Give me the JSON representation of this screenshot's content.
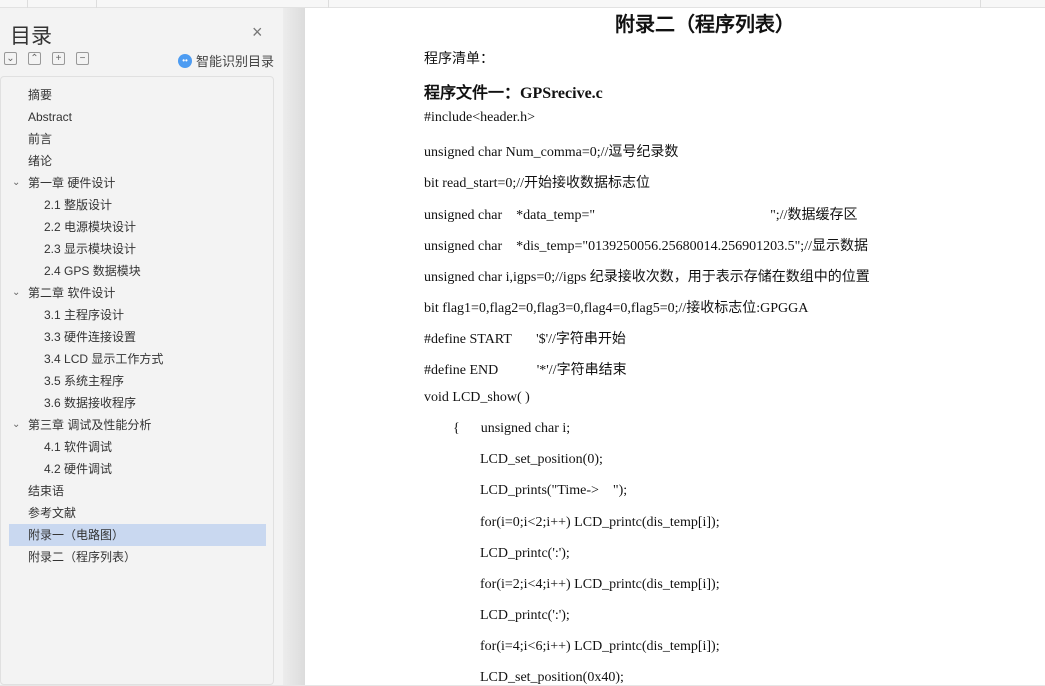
{
  "sidebar": {
    "title": "目录",
    "close": "×",
    "controls": [
      "⌄",
      "⌃",
      "+",
      "−"
    ],
    "smart_label": "智能识别目录",
    "items": [
      {
        "label": "摘要",
        "level": 1
      },
      {
        "label": "Abstract",
        "level": 1
      },
      {
        "label": "前言",
        "level": 1
      },
      {
        "label": "绪论",
        "level": 1
      },
      {
        "label": "第一章  硬件设计",
        "level": 1,
        "expanded": true
      },
      {
        "label": "2.1  整版设计",
        "level": 2
      },
      {
        "label": "2.2  电源模块设计",
        "level": 2
      },
      {
        "label": "2.3  显示模块设计",
        "level": 2
      },
      {
        "label": "2.4 GPS 数据模块",
        "level": 2
      },
      {
        "label": "第二章  软件设计",
        "level": 1,
        "expanded": true
      },
      {
        "label": "3.1  主程序设计",
        "level": 2
      },
      {
        "label": "3.3  硬件连接设置",
        "level": 2
      },
      {
        "label": "3.4 LCD 显示工作方式",
        "level": 2
      },
      {
        "label": "3.5  系统主程序",
        "level": 2
      },
      {
        "label": "3.6  数据接收程序",
        "level": 2
      },
      {
        "label": "第三章   调试及性能分析",
        "level": 1,
        "expanded": true
      },
      {
        "label": "4.1 软件调试",
        "level": 2
      },
      {
        "label": "4.2 硬件调试",
        "level": 2
      },
      {
        "label": "结束语",
        "level": 1
      },
      {
        "label": "参考文献",
        "level": 1
      },
      {
        "label": "附录一（电路图）",
        "level": 1,
        "selected": true
      },
      {
        "label": "附录二（程序列表）",
        "level": 1
      }
    ]
  },
  "document": {
    "title": "附录二（程序列表）",
    "lines": [
      {
        "text": "程序清单：",
        "indent": 0
      },
      {
        "text": "程序文件一：GPSrecive.c",
        "indent": 0,
        "heading": true
      },
      {
        "text": "#include<header.h>",
        "indent": 0
      },
      {
        "text": "unsigned char Num_comma=0;//逗号纪录数",
        "indent": 0
      },
      {
        "text": "bit read_start=0;//开始接收数据标志位",
        "indent": 0
      },
      {
        "text": "unsigned char    *data_temp=\"                                                  \";//数据缓存区",
        "indent": 0
      },
      {
        "text": "unsigned char    *dis_temp=\"0139250056.25680014.256901203.5\";//显示数据",
        "indent": 0
      },
      {
        "text": "unsigned char i,igps=0;//igps 纪录接收次数，用于表示存储在数组中的位置",
        "indent": 0
      },
      {
        "text": "bit flag1=0,flag2=0,flag3=0,flag4=0,flag5=0;//接收标志位:GPGGA",
        "indent": 0
      },
      {
        "text": "#define START       '$'//字符串开始",
        "indent": 0
      },
      {
        "text": "#define END           '*'//字符串结束",
        "indent": 0
      },
      {
        "text": "void LCD_show( )",
        "indent": 0
      },
      {
        "text": "{      unsigned char i;",
        "indent": 1
      },
      {
        "text": "LCD_set_position(0);",
        "indent": 2
      },
      {
        "text": "LCD_prints(\"Time->    \");",
        "indent": 2
      },
      {
        "text": "for(i=0;i<2;i++) LCD_printc(dis_temp[i]);",
        "indent": 2
      },
      {
        "text": "LCD_printc(':');",
        "indent": 2
      },
      {
        "text": "for(i=2;i<4;i++) LCD_printc(dis_temp[i]);",
        "indent": 2
      },
      {
        "text": "LCD_printc(':');",
        "indent": 2
      },
      {
        "text": "for(i=4;i<6;i++) LCD_printc(dis_temp[i]);",
        "indent": 2
      },
      {
        "text": "LCD_set_position(0x40);",
        "indent": 2
      }
    ]
  }
}
